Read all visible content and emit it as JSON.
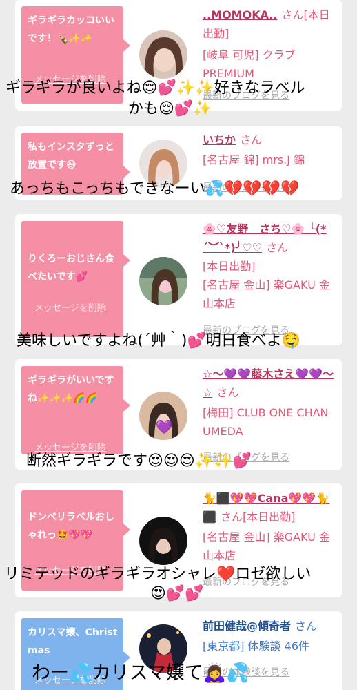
{
  "cards": [
    {
      "message": "ギラギラカッコいいです！🍾✨✨",
      "delete_label": "メッセージを削除",
      "name": "..MOMOKA..",
      "honorific": "さん",
      "status": "[本日出勤]",
      "shop": "[岐阜 可児] クラブPREMIUM",
      "blog_label": "最新のブログを見る",
      "caption_lines": [
        "ギラギラが良いよね😌💕✨✨好きなラベル",
        "かも😌💕✨"
      ]
    },
    {
      "message": "私もインスタずっと放置です😄",
      "delete_label": "メッセージを削除",
      "name": "いちか",
      "honorific": "さん",
      "shop": "[名古屋 錦] mrs.J 錦",
      "blog_label": "最新のブログを見る",
      "caption_lines": [
        "あっちもこっちもできなーい💦💔💔💔💔"
      ]
    },
    {
      "message": "りくろーおじさん食べたいです💕",
      "delete_label": "メッセージを削除",
      "name": "🌸♡友野　さち♡🌸 ╰(*´︶`*)╯♡♡",
      "honorific": "さん",
      "status": "[本日出勤]",
      "shop": "[名古屋 金山] 楽GAKU 金山本店",
      "blog_label": "最新のブログを見る",
      "caption_lines": [
        "美味しいですよね(´艸｀)💕明日食べよ🤤"
      ]
    },
    {
      "message": "ギラギラがいいですね✨✨✨🌈🌈",
      "delete_label": "メッセージを削除",
      "name": "☆〜💜💜藤木さえ💜💜〜☆",
      "honorific": "さん",
      "shop": "[梅田] CLUB ONE CHAN UMEDA",
      "blog_label": "最新のブログを見る",
      "caption_lines": [
        "断然ギラギラです😍😍😍✨✨💕"
      ]
    },
    {
      "message": "ドンペリラベルおしゃれっ🤩💖💖",
      "delete_label": "メッセージを削除",
      "name": "🐈⬛💖💖Cana💖💖🐈⬛",
      "honorific": "さん",
      "status": "[本日出勤]",
      "shop": "[名古屋 金山] 楽GAKU 金山本店",
      "blog_label": "最新のブログを見る",
      "caption_lines": [
        "リミテッドのギラギラオシャレ❤️ロゼ欲しい",
        "😍💕💕"
      ]
    },
    {
      "message": "カリスマ嬢、Christmas",
      "delete_label": "メッセージを削除",
      "name": "前田健哉@傾奇者",
      "honorific": "さん",
      "shop": "[東京都] 体験談 46件",
      "blog_label": "最新の体験談を見る",
      "caption_lines": [
        "わー💦カリスマ嬢て🙇‍♀️💦"
      ]
    }
  ],
  "colors": {
    "pink_bubble": "#f48fa6",
    "blue_bubble": "#7fb3ee",
    "pink_text": "#e05878",
    "blue_text": "#3e77c2"
  },
  "icons": [
    "avatar-photo"
  ]
}
